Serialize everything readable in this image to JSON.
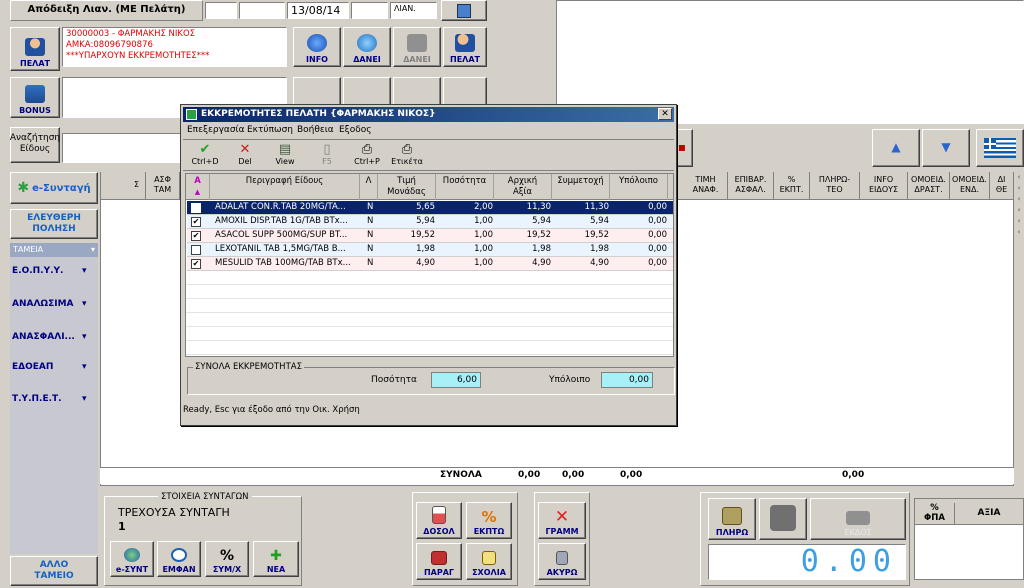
{
  "header": {
    "receipt_type": "Απόδειξη Λιαν. (ΜΕ Πελάτη)",
    "date": "13/08/14",
    "series": "ΛΙΑΝ."
  },
  "customer": {
    "button_label": "ΠΕΛΑΤ",
    "line1": "30000003 - ΦΑΡΜΑΚΗΣ ΝΙΚΟΣ",
    "line2": "ΑΜΚΑ:08096790876",
    "line3": "***ΥΠΑΡΧΟΥΝ ΕΚΚΡΕΜΟΤΗΤΕΣ***"
  },
  "top_buttons": {
    "info": "INFO",
    "danei": "ΔΑΝΕΙ",
    "danei2": "ΔΑΝΕΙ",
    "pelat": "ΠΕΛΑΤ"
  },
  "bonus_label": "BONUS",
  "search_label_1": "Αναζήτηση",
  "search_label_2": "Είδους",
  "e_syntagi": "e-Συνταγή",
  "free_city_1": "ΕΛΕΥΘΕΡΗ",
  "free_city_2": "ΠΟΛΗΣΗ",
  "tameia_label": "ΤΑΜΕΙΑ",
  "funds": [
    "Ε.Ο.Π.Υ.Υ.",
    "ΑΝΑΛΩΣΙΜΑ",
    "ΑΝΑΣΦΑΛΙ...",
    "ΕΔΟΕΑΠ",
    "Τ.Υ.Π.Ε.Τ."
  ],
  "other_fund_1": "ΑΛΛΟ",
  "other_fund_2": "ΤΑΜΕΙΟ",
  "main_headers": {
    "sigma": "Σ",
    "asf_1": "ΑΣΦ",
    "asf_2": "ΤΑΜ",
    "timh_1": "ΤΙΜΗ",
    "timh_2": "ΑΝΑΦ.",
    "epivar_1": "ΕΠΙΒΑΡ.",
    "epivar_2": "ΑΣΦΑΛ.",
    "ekpt_1": "%",
    "ekpt_2": "ΕΚΠΤ.",
    "plhrw_1": "ΠΛΗΡΩ-",
    "plhrw_2": "ΤΕΟ",
    "info_1": "INFO",
    "info_2": "ΕΙΔΟΥΣ",
    "omoeid_1": "ΟΜΟΕΙΔ.",
    "omoeid_2": "ΔΡΑΣΤ.",
    "omoeid_end_1": "ΟΜΟΕΙΔ.",
    "omoeid_end_2": "ΕΝΔ.",
    "di_1": "ΔΙ",
    "di_2": "ΘΕ"
  },
  "totals": {
    "label": "ΣΥΝΟΛΑ",
    "v1": "0,00",
    "v2": "0,00",
    "v3": "0,00",
    "v4": "0,00"
  },
  "prescriptions": {
    "group_title": "ΣΤΟΙΧΕΙΑ ΣΥΝΤΑΓΩΝ",
    "current": "ΤΡΕΧΟΥΣΑ ΣΥΝΤΑΓΗ",
    "number": "1",
    "b_esynt": "e-ΣΥΝΤ",
    "b_emfan": "ΕΜΦΑΝ",
    "b_symx": "ΣΥΜ/Χ",
    "b_nea": "ΝΕΑ"
  },
  "bottom_buttons": {
    "dosol": "ΔΟΣΟΛ",
    "ekptw": "ΕΚΠΤΩ",
    "gramm": "ΓΡΑΜΜ",
    "parag": "ΠΑΡΑΓ",
    "sxolia": "ΣΧΟΛΙΑ",
    "akyrw": "ΑΚΥΡΩ",
    "plhrw": "ΠΛΗΡΩ",
    "ekdos": "ΕΚΔΟΣ"
  },
  "amount_display": "0.00",
  "vat": {
    "fpa_1": "%",
    "fpa_2": "ΦΠΑ",
    "axia": "ΑΞΙΑ"
  },
  "dialog": {
    "title": "ΕΚΚΡΕΜΟΤΗΤΕΣ ΠΕΛΑΤΗ  {ΦΑΡΜΑΚΗΣ ΝΙΚΟΣ}",
    "menu": [
      "Επεξεργασία",
      "Εκτύπωση",
      "Βοήθεια",
      "Εξοδος"
    ],
    "toolbar": {
      "ctrl_d": "Ctrl+D",
      "del": "Del",
      "view": "View",
      "f5": "F5",
      "ctrl_p": "Ctrl+P",
      "label": "Ετικέτα"
    },
    "columns": {
      "sort": "A",
      "desc": "Περιγραφή Είδους",
      "l": "Λ",
      "unit_1": "Τιμή",
      "unit_2": "Μονάδας",
      "qty": "Ποσότητα",
      "init_1": "Αρχική",
      "init_2": "Αξία",
      "part": "Συμμετοχή",
      "rem": "Υπόλοιπο"
    },
    "rows": [
      {
        "checked": false,
        "desc": "ADALAT CON.R.TAB 20MG/TA...",
        "l": "N",
        "unit": "5,65",
        "qty": "2,00",
        "init": "11,30",
        "part": "11,30",
        "rem": "0,00"
      },
      {
        "checked": true,
        "desc": "AMOXIL DISP.TAB 1G/TAB BTx...",
        "l": "N",
        "unit": "5,94",
        "qty": "1,00",
        "init": "5,94",
        "part": "5,94",
        "rem": "0,00"
      },
      {
        "checked": true,
        "desc": "ASACOL SUPP 500MG/SUP BT...",
        "l": "N",
        "unit": "19,52",
        "qty": "1,00",
        "init": "19,52",
        "part": "19,52",
        "rem": "0,00"
      },
      {
        "checked": false,
        "desc": "LEXOTANIL TAB 1,5MG/TAB B...",
        "l": "N",
        "unit": "1,98",
        "qty": "1,00",
        "init": "1,98",
        "part": "1,98",
        "rem": "0,00"
      },
      {
        "checked": true,
        "desc": "MESULID TAB 100MG/TAB BTx...",
        "l": "N",
        "unit": "4,90",
        "qty": "1,00",
        "init": "4,90",
        "part": "4,90",
        "rem": "0,00"
      }
    ],
    "totals_group": "ΣΥΝΟΛΑ ΕΚΚΡΕΜΟΤΗΤΑΣ",
    "qty_label": "Ποσότητα",
    "qty_value": "6,00",
    "rem_label": "Υπόλοιπο",
    "rem_value": "0,00",
    "status": "Ready, Esc για έξοδο από την Οικ. Χρήση"
  }
}
